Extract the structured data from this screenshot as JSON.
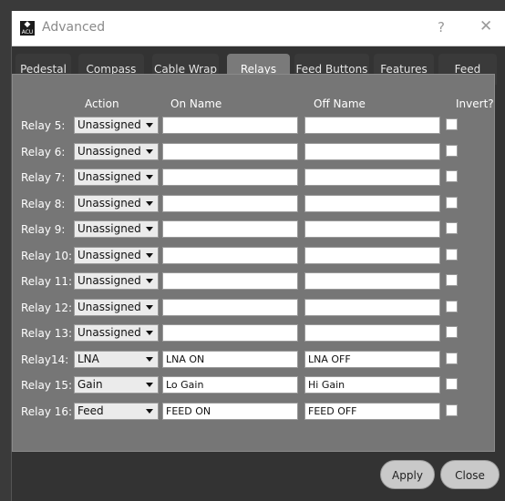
{
  "window": {
    "title": "Advanced",
    "app_icon_text": "ACU",
    "help_label": "?",
    "close_label": "✕"
  },
  "tabs": [
    {
      "label": "Pedestal",
      "active": false
    },
    {
      "label": "Compass",
      "active": false
    },
    {
      "label": "Cable Wrap",
      "active": false
    },
    {
      "label": "Relays",
      "active": true
    },
    {
      "label": "Feed Buttons",
      "active": false
    },
    {
      "label": "Features",
      "active": false
    },
    {
      "label": "Feed",
      "active": false
    }
  ],
  "columns": {
    "action": "Action",
    "on_name": "On Name",
    "off_name": "Off Name",
    "invert": "Invert?"
  },
  "relays": [
    {
      "label": "Relay 5:",
      "action": "Unassigned",
      "on_name": "",
      "off_name": "",
      "invert": false
    },
    {
      "label": "Relay 6:",
      "action": "Unassigned",
      "on_name": "",
      "off_name": "",
      "invert": false
    },
    {
      "label": "Relay 7:",
      "action": "Unassigned",
      "on_name": "",
      "off_name": "",
      "invert": false
    },
    {
      "label": "Relay 8:",
      "action": "Unassigned",
      "on_name": "",
      "off_name": "",
      "invert": false
    },
    {
      "label": "Relay 9:",
      "action": "Unassigned",
      "on_name": "",
      "off_name": "",
      "invert": false
    },
    {
      "label": "Relay 10:",
      "action": "Unassigned",
      "on_name": "",
      "off_name": "",
      "invert": false
    },
    {
      "label": "Relay 11:",
      "action": "Unassigned",
      "on_name": "",
      "off_name": "",
      "invert": false
    },
    {
      "label": "Relay 12:",
      "action": "Unassigned",
      "on_name": "",
      "off_name": "",
      "invert": false
    },
    {
      "label": "Relay 13:",
      "action": "Unassigned",
      "on_name": "",
      "off_name": "",
      "invert": false
    },
    {
      "label": "Relay14:",
      "action": "LNA",
      "on_name": "LNA ON",
      "off_name": "LNA OFF",
      "invert": false
    },
    {
      "label": "Relay 15:",
      "action": "Gain",
      "on_name": "Lo Gain",
      "off_name": "Hi Gain",
      "invert": false
    },
    {
      "label": "Relay 16:",
      "action": "Feed",
      "on_name": "FEED ON",
      "off_name": "FEED OFF",
      "invert": false
    }
  ],
  "buttons": {
    "apply": "Apply",
    "close": "Close"
  }
}
